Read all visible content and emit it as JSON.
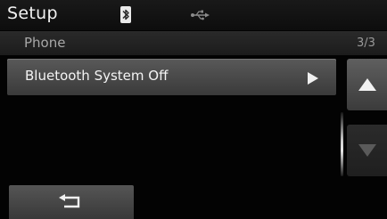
{
  "header": {
    "title": "Setup",
    "bluetooth_icon": "bluetooth-icon",
    "usb_icon": "usb-icon"
  },
  "subheader": {
    "title": "Phone",
    "page_indicator": "3/3"
  },
  "list": {
    "items": [
      {
        "label": "Bluetooth System Off",
        "icon": "play-arrow-icon"
      }
    ]
  },
  "scroll": {
    "up_icon": "triangle-up-icon",
    "down_icon": "triangle-down-icon"
  },
  "footer": {
    "back_icon": "return-arrow-icon"
  },
  "colors": {
    "background": "#030303",
    "item": "#4a4a4a",
    "text": "#f4f4f4",
    "muted": "#a8a8a8"
  }
}
